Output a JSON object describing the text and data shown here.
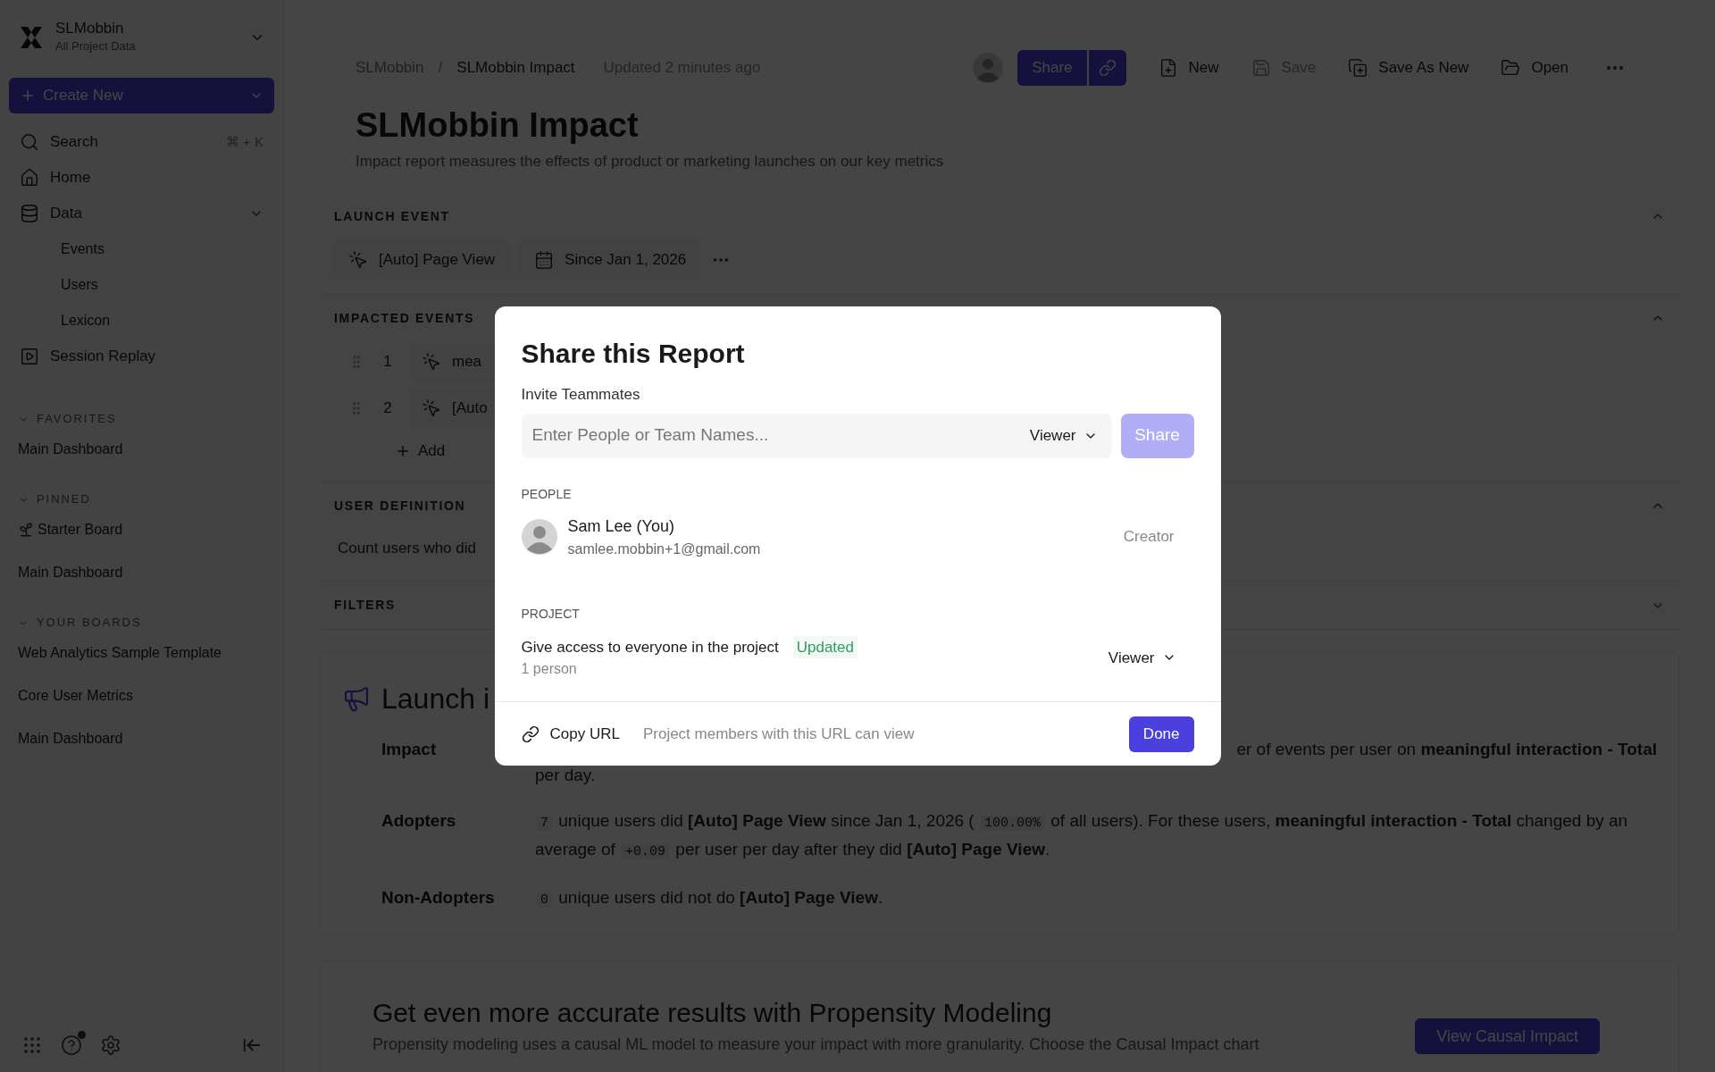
{
  "sidebar": {
    "workspace": {
      "name": "SLMobbin",
      "subtitle": "All Project Data"
    },
    "create_button": "Create New",
    "nav": [
      {
        "kind": "search",
        "label": "Search",
        "shortcut": "⌘ + K"
      },
      {
        "kind": "home",
        "label": "Home"
      },
      {
        "kind": "data",
        "label": "Data",
        "expanded": true,
        "children": [
          {
            "label": "Events"
          },
          {
            "label": "Users"
          },
          {
            "label": "Lexicon"
          }
        ]
      },
      {
        "kind": "replay",
        "label": "Session Replay"
      }
    ],
    "sections": [
      {
        "title": "FAVORITES",
        "expanded": true,
        "items": [
          {
            "kind": "plain",
            "label": "Main Dashboard"
          }
        ]
      },
      {
        "title": "PINNED",
        "expanded": true,
        "items": [
          {
            "kind": "starter",
            "label": "Starter Board"
          },
          {
            "kind": "plain",
            "label": "Main Dashboard"
          }
        ]
      },
      {
        "title": "YOUR BOARDS",
        "expanded": true,
        "items": [
          {
            "kind": "plain",
            "label": "Web Analytics Sample Template"
          },
          {
            "kind": "plain",
            "label": "Core User Metrics"
          },
          {
            "kind": "plain",
            "label": "Main Dashboard"
          }
        ]
      }
    ]
  },
  "header": {
    "breadcrumbs": [
      "SLMobbin",
      "SLMobbin Impact"
    ],
    "breadcrumb_separator": "/",
    "updated": "Updated 2 minutes ago",
    "share_button": "Share",
    "toolbar": [
      {
        "kind": "new",
        "label": "New",
        "disabled": false
      },
      {
        "kind": "save",
        "label": "Save",
        "disabled": true
      },
      {
        "kind": "save_as",
        "label": "Save As New",
        "disabled": false
      },
      {
        "kind": "open",
        "label": "Open",
        "disabled": false
      }
    ]
  },
  "title": "SLMobbin Impact",
  "description": "Impact report measures the effects of product or marketing launches on our key metrics",
  "query": [
    {
      "kind": "launch",
      "title": "LAUNCH EVENT",
      "expanded": true,
      "event": "[Auto] Page View",
      "date": "Since Jan 1, 2026"
    },
    {
      "kind": "impacted",
      "title": "IMPACTED EVENTS",
      "expanded": true,
      "items": [
        {
          "index": "1",
          "label": "mea"
        },
        {
          "index": "2",
          "label": "[Auto"
        }
      ],
      "add": "Add"
    },
    {
      "kind": "user",
      "title": "USER DEFINITION",
      "expanded": true,
      "text": "Count users who did"
    },
    {
      "kind": "filters",
      "title": "FILTERS",
      "expanded": false
    }
  ],
  "results": {
    "heading": "Launch i",
    "rows": [
      {
        "label": "Impact",
        "lines": [
          [
            {
              "kind": "text",
              "text": "er of events per user on "
            },
            {
              "kind": "bold",
              "text": "meaningful interaction - Total"
            }
          ],
          [
            {
              "kind": "text",
              "text": "per day."
            }
          ]
        ],
        "kind": "cut"
      },
      {
        "label": "Adopters",
        "lines": [
          [
            {
              "kind": "code",
              "text": "7"
            },
            {
              "kind": "text",
              "text": " unique users did "
            },
            {
              "kind": "bold",
              "text": "[Auto] Page View"
            },
            {
              "kind": "text",
              "text": " since Jan 1, 2026 ( "
            },
            {
              "kind": "code",
              "text": "100.00%"
            },
            {
              "kind": "text",
              "text": " of all users). For these users, "
            },
            {
              "kind": "bold",
              "text": "meaningful interaction - Total"
            },
            {
              "kind": "text",
              "text": " changed by an average of "
            },
            {
              "kind": "code",
              "text": "+0.09"
            },
            {
              "kind": "text",
              "text": " per user per day after they did "
            },
            {
              "kind": "bold",
              "text": "[Auto] Page View"
            },
            {
              "kind": "text",
              "text": "."
            }
          ]
        ],
        "kind": "plain"
      },
      {
        "label": "Non-Adopters",
        "lines": [
          [
            {
              "kind": "code",
              "text": "0"
            },
            {
              "kind": "text",
              "text": " unique users did not do "
            },
            {
              "kind": "bold",
              "text": "[Auto] Page View"
            },
            {
              "kind": "text",
              "text": "."
            }
          ]
        ],
        "kind": "plain"
      }
    ]
  },
  "promo": {
    "title": "Get even more accurate results with Propensity Modeling",
    "text": "Propensity modeling uses a causal ML model to measure your impact with more granularity. Choose the Causal Impact chart",
    "button": "View Causal Impact"
  },
  "dialog": {
    "title": "Share this Report",
    "invite_label": "Invite Teammates",
    "invite": {
      "placeholder": "Enter People or Team Names...",
      "role": "Viewer"
    },
    "share_button": {
      "label": "Share",
      "disabled": true
    },
    "people_heading": "PEOPLE",
    "people": [
      {
        "name": "Sam Lee (You)",
        "email": "samlee.mobbin+1@gmail.com",
        "role": "Creator"
      }
    ],
    "project_heading": "PROJECT",
    "project": {
      "text": "Give access to everyone in the project",
      "badge": "Updated",
      "subtitle": "1 person",
      "role": "Viewer"
    },
    "copy_url": "Copy URL",
    "url_note": "Project members with this URL can view",
    "done": "Done"
  }
}
